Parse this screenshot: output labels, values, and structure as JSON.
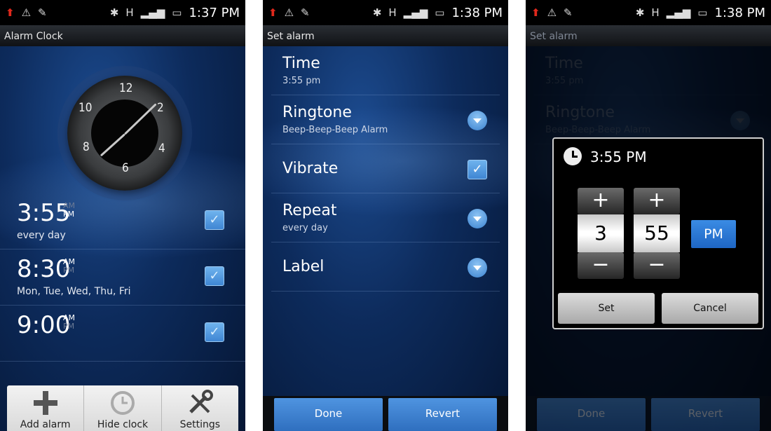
{
  "status": {
    "time_1": "1:37 PM",
    "time_2": "1:38 PM",
    "time_3": "1:38 PM",
    "network": "H"
  },
  "screen1": {
    "title": "Alarm Clock",
    "clock_numbers": [
      "12",
      "2",
      "4",
      "6",
      "8",
      "10"
    ],
    "alarms": [
      {
        "time": "3:55",
        "am": "AM",
        "pm": "PM",
        "active": "PM",
        "days": "every day",
        "enabled": true
      },
      {
        "time": "8:30",
        "am": "AM",
        "pm": "PM",
        "active": "AM",
        "days": "Mon, Tue, Wed, Thu, Fri",
        "enabled": true
      },
      {
        "time": "9:00",
        "am": "AM",
        "pm": "PM",
        "active": "AM",
        "days": "",
        "enabled": true
      }
    ],
    "bottom": {
      "add_alarm": "Add alarm",
      "hide_clock": "Hide clock",
      "settings": "Settings"
    }
  },
  "screen2": {
    "title": "Set alarm",
    "time_label": "Time",
    "time_value": "3:55 pm",
    "ringtone_label": "Ringtone",
    "ringtone_value": "Beep-Beep-Beep Alarm",
    "vibrate_label": "Vibrate",
    "vibrate_checked": true,
    "repeat_label": "Repeat",
    "repeat_value": "every day",
    "label_label": "Label",
    "done": "Done",
    "revert": "Revert"
  },
  "screen3": {
    "title": "Set alarm",
    "dialog_title": "3:55 PM",
    "hour": "3",
    "minute": "55",
    "ampm": "PM",
    "plus": "+",
    "minus": "−",
    "set": "Set",
    "cancel": "Cancel"
  },
  "colors": {
    "accent": "#3b82cf",
    "background": "#0d2b5c",
    "usb_icon": "#e0281c"
  }
}
